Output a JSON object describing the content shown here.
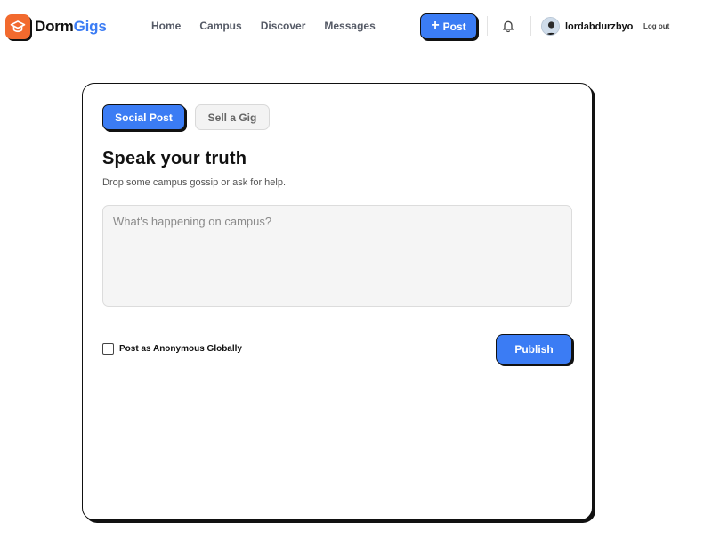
{
  "header": {
    "logo": {
      "part1": "Dorm",
      "part2": "Gigs",
      "icon": "graduation-cap-icon"
    },
    "nav": [
      "Home",
      "Campus",
      "Discover",
      "Messages"
    ],
    "post_button": {
      "label": "Post",
      "icon": "plus-icon"
    },
    "bell_icon": "bell-icon",
    "user": {
      "username": "lordabdurzbyo",
      "logout": "Log out"
    }
  },
  "composer": {
    "tabs": [
      "Social Post",
      "Sell a Gig"
    ],
    "active_tab": "Social Post",
    "title": "Speak your truth",
    "subtitle": "Drop some campus gossip or ask for help.",
    "textarea": {
      "placeholder": "What's happening on campus?",
      "value": ""
    },
    "anonymous_label": "Post as Anonymous Globally",
    "anonymous_checked": false,
    "publish_label": "Publish"
  },
  "colors": {
    "accent": "#3b7cf4",
    "logo_badge": "#f26a2e",
    "border": "#111111"
  }
}
